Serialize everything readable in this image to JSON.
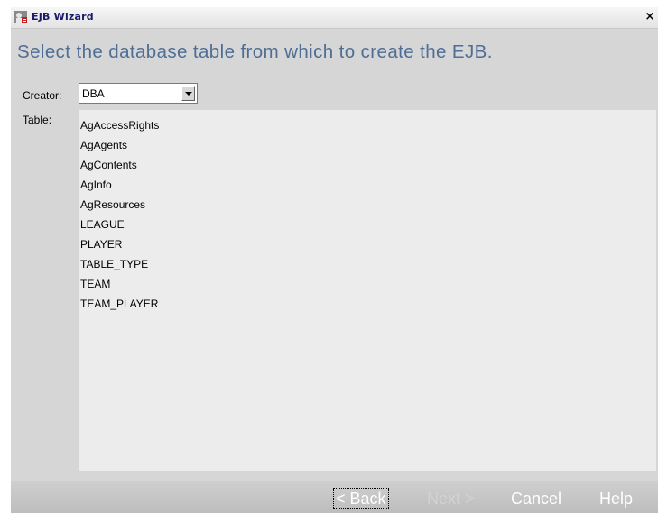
{
  "window": {
    "title": "EJB Wizard",
    "close_glyph": "×",
    "icon": "app-icon"
  },
  "heading": "Select the database table from which to create the EJB.",
  "creator": {
    "label": "Creator:",
    "value": "DBA"
  },
  "table": {
    "label": "Table:",
    "items": [
      "AgAccessRights",
      "AgAgents",
      "AgContents",
      "AgInfo",
      "AgResources",
      "LEAGUE",
      "PLAYER",
      "TABLE_TYPE",
      "TEAM",
      "TEAM_PLAYER"
    ]
  },
  "buttons": {
    "back": "< Back",
    "next": "Next >",
    "cancel": "Cancel",
    "help": "Help"
  },
  "colors": {
    "heading": "#4e6e95",
    "title_text": "#1a1a6a",
    "dialog_bg": "#d6d6d6",
    "list_bg": "#ececec",
    "disabled_text": "#d2d2d2"
  }
}
